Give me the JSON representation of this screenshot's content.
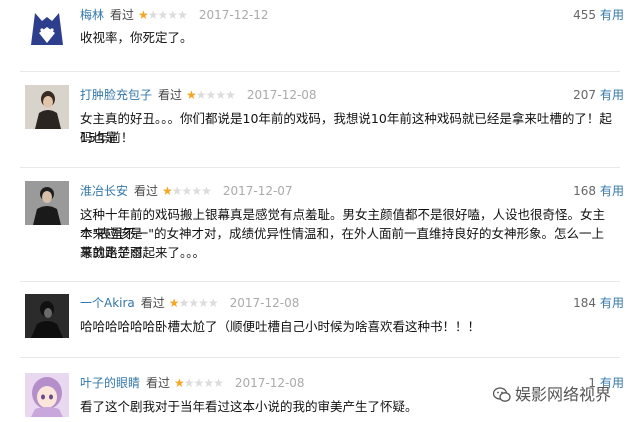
{
  "comments": [
    {
      "user": "梅林",
      "watched": "看过",
      "stars": 1,
      "date": "2017-12-12",
      "votes": "455",
      "useful_label": "有用",
      "text": "收视率，你死定了。",
      "avatar": "wolf-avatar-icon"
    },
    {
      "user": "打肿脸充包子",
      "watched": "看过",
      "stars": 1,
      "date": "2017-12-08",
      "votes": "207",
      "useful_label": "有用",
      "text_line1": "女主真的好丑。。。你们都说是10年前的戏码，我想说10年前这种戏码就已经是拿来吐槽的了！起码也是",
      "text_line2": "15年前！",
      "avatar": "person-avatar-icon"
    },
    {
      "user": "淮冶长安",
      "watched": "看过",
      "stars": 1,
      "date": "2017-12-07",
      "votes": "168",
      "useful_label": "有用",
      "text_line1": "这种十年前的戏码搬上银幕真是感觉有点羞耻。男女主颜值都不是很好嗑，人设也很奇怪。女主本来应该是",
      "text_line2": "个\"表里不一\"的女神才对，成绩优异性情温和，在外人面前一直维持良好的女神形象。怎么一上来就走楚雨",
      "text_line3": "荨的路子怼起来了。。。",
      "avatar": "person-avatar-icon"
    },
    {
      "user": "一个Akira",
      "watched": "看过",
      "stars": 1,
      "date": "2017-12-08",
      "votes": "184",
      "useful_label": "有用",
      "text": "哈哈哈哈哈哈卧槽太尬了（顺便吐槽自己小时候为啥喜欢看这种书！！！",
      "avatar": "dark-person-avatar-icon"
    },
    {
      "user": "叶子的眼睛",
      "watched": "看过",
      "stars": 1,
      "date": "2017-12-08",
      "votes": "1",
      "useful_label": "有用",
      "text": "看了这个剧我对于当年看过这本小说的我的审美产生了怀疑。",
      "avatar": "anime-girl-avatar-icon"
    }
  ],
  "watermark": {
    "text": "娱影网络视界",
    "icon": "wechat-icon"
  },
  "colors": {
    "link": "#3377aa",
    "star": "#f5a623",
    "star_off": "#dcdcdc",
    "date": "#aaaaaa"
  }
}
